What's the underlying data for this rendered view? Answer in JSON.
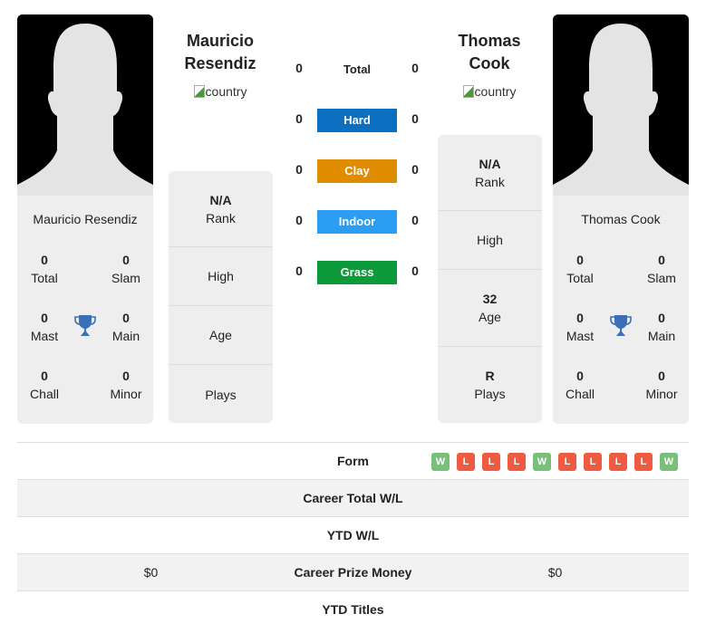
{
  "player1": {
    "name_line1": "Mauricio",
    "name_line2": "Resendiz",
    "full_name": "Mauricio Resendiz",
    "country_alt": "country",
    "titles": {
      "total": {
        "value": "0",
        "label": "Total"
      },
      "slam": {
        "value": "0",
        "label": "Slam"
      },
      "mast": {
        "value": "0",
        "label": "Mast"
      },
      "main": {
        "value": "0",
        "label": "Main"
      },
      "chall": {
        "value": "0",
        "label": "Chall"
      },
      "minor": {
        "value": "0",
        "label": "Minor"
      }
    },
    "stats": {
      "rank": {
        "value": "N/A",
        "label": "Rank"
      },
      "high": {
        "value": "",
        "label": "High"
      },
      "age": {
        "value": "",
        "label": "Age"
      },
      "plays": {
        "value": "",
        "label": "Plays"
      }
    }
  },
  "player2": {
    "name_line1": "Thomas",
    "name_line2": "Cook",
    "full_name": "Thomas Cook",
    "country_alt": "country",
    "titles": {
      "total": {
        "value": "0",
        "label": "Total"
      },
      "slam": {
        "value": "0",
        "label": "Slam"
      },
      "mast": {
        "value": "0",
        "label": "Mast"
      },
      "main": {
        "value": "0",
        "label": "Main"
      },
      "chall": {
        "value": "0",
        "label": "Chall"
      },
      "minor": {
        "value": "0",
        "label": "Minor"
      }
    },
    "stats": {
      "rank": {
        "value": "N/A",
        "label": "Rank"
      },
      "high": {
        "value": "",
        "label": "High"
      },
      "age": {
        "value": "32",
        "label": "Age"
      },
      "plays": {
        "value": "R",
        "label": "Plays"
      }
    }
  },
  "surfaces": [
    {
      "label": "Total",
      "p1": "0",
      "p2": "0",
      "color": ""
    },
    {
      "label": "Hard",
      "p1": "0",
      "p2": "0",
      "color": "#0c6fc0"
    },
    {
      "label": "Clay",
      "p1": "0",
      "p2": "0",
      "color": "#e08c00"
    },
    {
      "label": "Indoor",
      "p1": "0",
      "p2": "0",
      "color": "#2b9df2"
    },
    {
      "label": "Grass",
      "p1": "0",
      "p2": "0",
      "color": "#0d9a3a"
    }
  ],
  "table": {
    "form_label": "Form",
    "form": [
      "W",
      "L",
      "L",
      "L",
      "W",
      "L",
      "L",
      "L",
      "L",
      "W"
    ],
    "rows": [
      {
        "label": "Career Total W/L",
        "p1": "",
        "p2": ""
      },
      {
        "label": "YTD W/L",
        "p1": "",
        "p2": ""
      },
      {
        "label": "Career Prize Money",
        "p1": "$0",
        "p2": "$0"
      },
      {
        "label": "YTD Titles",
        "p1": "",
        "p2": ""
      }
    ]
  },
  "colors": {
    "trophy": "#3b6fb6",
    "win": "#78c07a",
    "loss": "#ee5a42"
  }
}
